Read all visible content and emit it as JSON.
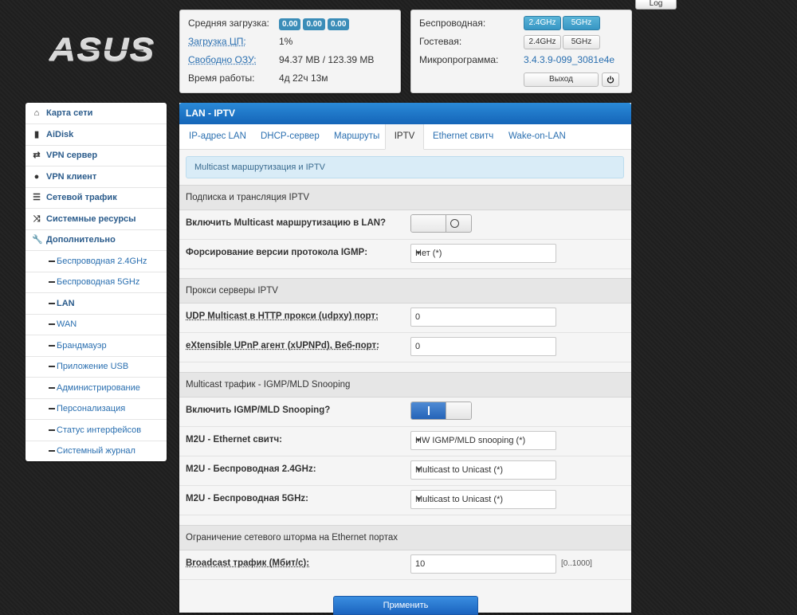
{
  "brand": {
    "logo_text": "ASUS"
  },
  "top_buttons": {
    "log": "Log"
  },
  "status": {
    "load_label": "Средняя загрузка:",
    "load_values": [
      "0.00",
      "0.00",
      "0.00"
    ],
    "cpu_label": "Загрузка ЦП:",
    "cpu_value": "1%",
    "ram_label": "Свободно ОЗУ:",
    "ram_value": "94.37 MB / 123.39 MB",
    "uptime_label": "Время работы:",
    "uptime_value": "4д 22ч 13м"
  },
  "wireless": {
    "wireless_label": "Беспроводная:",
    "guest_label": "Гостевая:",
    "firmware_label": "Микропрограмма:",
    "firmware_value": "3.4.3.9-099_3081e4e",
    "band_24": "2.4GHz",
    "band_5": "5GHz",
    "logout": "Выход",
    "power_icon": "power-icon"
  },
  "sidebar": {
    "items": [
      {
        "label": "Карта сети",
        "icon": "home-icon"
      },
      {
        "label": "AiDisk",
        "icon": "disk-icon"
      },
      {
        "label": "VPN сервер",
        "icon": "exchange-icon"
      },
      {
        "label": "VPN клиент",
        "icon": "globe-icon"
      },
      {
        "label": "Сетевой трафик",
        "icon": "list-icon"
      },
      {
        "label": "Системные ресурсы",
        "icon": "shuffle-icon"
      },
      {
        "label": "Дополнительно",
        "icon": "wrench-icon"
      }
    ],
    "subitems": [
      "Беспроводная 2.4GHz",
      "Беспроводная 5GHz",
      "LAN",
      "WAN",
      "Брандмауэр",
      "Приложение USB",
      "Администрирование",
      "Персонализация",
      "Статус интерфейсов",
      "Системный журнал"
    ],
    "active_subitem": "LAN"
  },
  "main": {
    "title": "LAN - IPTV",
    "tabs": [
      "IP-адрес LAN",
      "DHCP-сервер",
      "Маршруты",
      "IPTV",
      "Ethernet свитч",
      "Wake-on-LAN"
    ],
    "active_tab": "IPTV",
    "info": "Multicast маршрутизация и IPTV",
    "sections": {
      "subscription": "Подписка и трансляция IPTV",
      "proxy": "Прокси серверы IPTV",
      "snooping": "Multicast трафик - IGMP/MLD Snooping",
      "storm": "Ограничение сетевого шторма на Ethernet портах"
    },
    "fields": {
      "multicast_label": "Включить Multicast маршрутизацию в LAN?",
      "multicast_state": "off",
      "igmp_label": "Форсирование версии протокола IGMP:",
      "igmp_value": "Нет (*)",
      "udpxy_label": "UDP Multicast в HTTP прокси (udpxy) порт:",
      "udpxy_value": "0",
      "xupnpd_label": "eXtensible UPnP агент (xUPNPd), Веб-порт:",
      "xupnpd_value": "0",
      "snooping_label": "Включить IGMP/MLD Snooping?",
      "snooping_state": "on",
      "m2u_eth_label": "M2U - Ethernet свитч:",
      "m2u_eth_value": "HW IGMP/MLD snooping (*)",
      "m2u_24_label": "M2U - Беспроводная 2.4GHz:",
      "m2u_24_value": "Multicast to Unicast (*)",
      "m2u_5_label": "M2U - Беспроводная 5GHz:",
      "m2u_5_value": "Multicast to Unicast (*)",
      "broadcast_label": "Broadcast трафик (Мбит/с):",
      "broadcast_value": "10",
      "broadcast_range": "[0..1000]"
    },
    "apply": "Применить"
  }
}
